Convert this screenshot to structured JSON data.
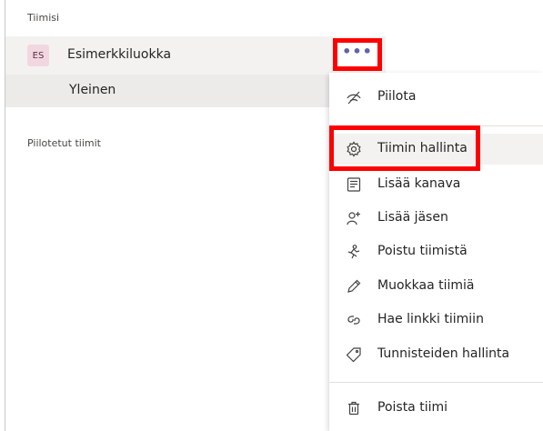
{
  "sidebar": {
    "teams_header": "Tiimisi",
    "team": {
      "avatar_initials": "ES",
      "name": "Esimerkkiluokka",
      "more_label": "•••"
    },
    "channel": {
      "name": "Yleinen"
    },
    "hidden_header": "Piilotetut tiimit"
  },
  "menu": {
    "items": [
      {
        "label": "Piilota",
        "icon": "hide-icon"
      },
      {
        "label": "Tiimin hallinta",
        "icon": "gear-icon"
      },
      {
        "label": "Lisää kanava",
        "icon": "add-channel-icon"
      },
      {
        "label": "Lisää jäsen",
        "icon": "add-member-icon"
      },
      {
        "label": "Poistu tiimistä",
        "icon": "leave-icon"
      },
      {
        "label": "Muokkaa tiimiä",
        "icon": "pencil-icon"
      },
      {
        "label": "Hae linkki tiimiin",
        "icon": "link-icon"
      },
      {
        "label": "Tunnisteiden hallinta",
        "icon": "tag-icon"
      },
      {
        "label": "Poista tiimi",
        "icon": "trash-icon"
      }
    ]
  },
  "colors": {
    "accent": "#6264a7",
    "highlight_border": "#ff0000",
    "avatar_bg": "#f2d7e1"
  }
}
